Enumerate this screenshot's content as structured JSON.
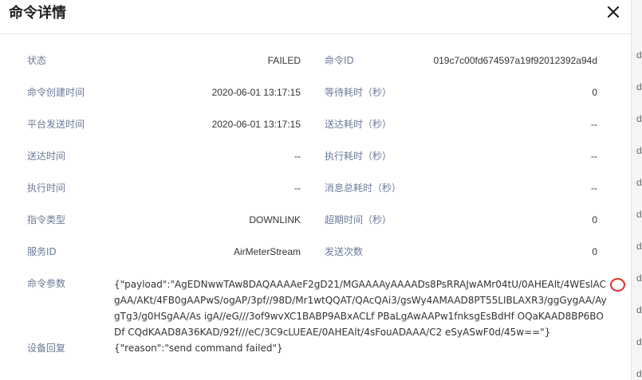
{
  "dialog": {
    "title": "命令详情"
  },
  "fields": {
    "status_label": "状态",
    "status_value": "FAILED",
    "command_id_label": "命令ID",
    "command_id_value": "019c7c00fd674597a19f92012392a94d",
    "created_time_label": "命令创建时间",
    "created_time_value": "2020-06-01 13:17:15",
    "wait_duration_label": "等待耗时（秒）",
    "wait_duration_value": "0",
    "platform_send_time_label": "平台发送时间",
    "platform_send_time_value": "2020-06-01 13:17:15",
    "delivery_duration_label": "送达耗时（秒）",
    "delivery_duration_value": "--",
    "delivery_time_label": "送达时间",
    "delivery_time_value": "--",
    "execution_duration_label": "执行耗时（秒）",
    "execution_duration_value": "--",
    "execution_time_label": "执行时间",
    "execution_time_value": "--",
    "total_message_duration_label": "消息总耗时（秒）",
    "total_message_duration_value": "--",
    "command_type_label": "指令类型",
    "command_type_value": "DOWNLINK",
    "timeout_label": "超期时间（秒）",
    "timeout_value": "0",
    "service_id_label": "服务ID",
    "service_id_value": "AirMeterStream",
    "send_count_label": "发送次数",
    "send_count_value": "0",
    "command_params_label": "命令参数",
    "command_params_value": "{\"payload\":\"AgEDNwwTAw8DAQAAAAeF2gD21/MGAAAAyAAAADs8PsRRAJwAMr04tU/0AHEAlt/4WEslACgAA/AKt/4FB0gAAPwS/ogAP/3pf//98D/Mr1wtQQAT/QAcQAi3/gsWy4AMAAD8PT55LIBLAXR3/ggGygAA/Ay gTg3/g0HSgAA/As igA//eG///3of9wvXC1BABP9ABxACLf PBaLgAwAAPw1fnksgEsBdHf OQaKAAD8BP6BODf CQdKAAD8A36KAD/92f///eC/3C9cLUEAE/0AHEAlt/4sFouADAAA/C2 eSyASwF0d/45w==\"}",
    "device_reply_label": "设备回复",
    "device_reply_value": "{\"reason\":\"send command failed\"}"
  },
  "colors": {
    "label": "#6b7a99",
    "value": "#333333",
    "annotation": "#e0302b"
  },
  "icons": {
    "close": "close-icon"
  },
  "background_strip": {
    "chars": [
      "d",
      "d",
      "d",
      "d",
      "d",
      "d",
      "d",
      "d",
      "d",
      "d",
      "d",
      "d"
    ]
  }
}
